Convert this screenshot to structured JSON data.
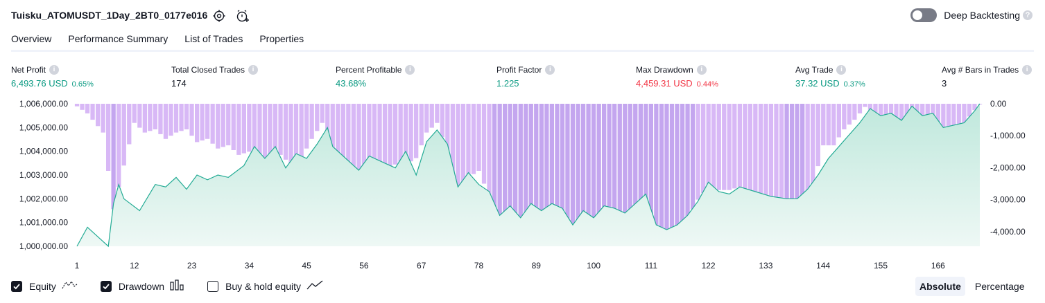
{
  "header": {
    "strategy_title": "Tuisku_ATOMUSDT_1Day_2BT0_0177e016",
    "deep_backtesting_label": "Deep Backtesting",
    "deep_backtesting_enabled": false,
    "help_glyph": "?"
  },
  "tabs": [
    {
      "label": "Overview",
      "active": true
    },
    {
      "label": "Performance Summary",
      "active": false
    },
    {
      "label": "List of Trades",
      "active": false
    },
    {
      "label": "Properties",
      "active": false
    }
  ],
  "metrics": [
    {
      "label": "Net Profit",
      "value": "6,493.76 USD",
      "pct": "0.65%",
      "color": "green"
    },
    {
      "label": "Total Closed Trades",
      "value": "174",
      "pct": "",
      "color": "dark"
    },
    {
      "label": "Percent Profitable",
      "value": "43.68%",
      "pct": "",
      "color": "green"
    },
    {
      "label": "Profit Factor",
      "value": "1.225",
      "pct": "",
      "color": "green"
    },
    {
      "label": "Max Drawdown",
      "value": "4,459.31 USD",
      "pct": "0.44%",
      "color": "red"
    },
    {
      "label": "Avg Trade",
      "value": "37.32 USD",
      "pct": "0.37%",
      "color": "green"
    },
    {
      "label": "Avg # Bars in Trades",
      "value": "3",
      "pct": "",
      "color": "dark"
    }
  ],
  "colors": {
    "equity_line": "#22ab94",
    "equity_fill_top": "#c8ebe2",
    "drawdown_bar": "#d8b8f6",
    "drawdown_bar_deep": "#c4a6ef",
    "green": "#089981",
    "red": "#f23645"
  },
  "chart_data": {
    "type": "area",
    "x_ticks": [
      "1",
      "12",
      "23",
      "34",
      "45",
      "56",
      "67",
      "78",
      "89",
      "100",
      "111",
      "122",
      "133",
      "144",
      "155",
      "166"
    ],
    "x_range": [
      1,
      174
    ],
    "left_axis": {
      "ticks": [
        "1,006,000.00",
        "1,005,000.00",
        "1,004,000.00",
        "1,003,000.00",
        "1,002,000.00",
        "1,001,000.00",
        "1,000,000.00"
      ],
      "ylim": [
        1000000,
        1006000
      ]
    },
    "right_axis": {
      "ticks": [
        "0.00",
        "-1,000.00",
        "-2,000.00",
        "-3,000.00",
        "-4,000.00"
      ],
      "ylim": [
        -4459.31,
        0
      ]
    },
    "series": [
      {
        "type": "area",
        "equity_keypoints": [
          [
            1,
            1000000
          ],
          [
            3,
            1000800
          ],
          [
            6,
            1000200
          ],
          [
            7,
            1000000
          ],
          [
            8,
            1001800
          ],
          [
            9,
            1002600
          ],
          [
            10,
            1002000
          ],
          [
            13,
            1001500
          ],
          [
            16,
            1002600
          ],
          [
            18,
            1002500
          ],
          [
            20,
            1002900
          ],
          [
            22,
            1002400
          ],
          [
            24,
            1003000
          ],
          [
            26,
            1002800
          ],
          [
            28,
            1003000
          ],
          [
            30,
            1002900
          ],
          [
            33,
            1003400
          ],
          [
            35,
            1004200
          ],
          [
            37,
            1003700
          ],
          [
            39,
            1004200
          ],
          [
            41,
            1003300
          ],
          [
            43,
            1003900
          ],
          [
            45,
            1003700
          ],
          [
            47,
            1004300
          ],
          [
            49,
            1005000
          ],
          [
            50,
            1004200
          ],
          [
            52,
            1003800
          ],
          [
            55,
            1003200
          ],
          [
            57,
            1003800
          ],
          [
            59,
            1003600
          ],
          [
            62,
            1003300
          ],
          [
            64,
            1004000
          ],
          [
            66,
            1003000
          ],
          [
            68,
            1004400
          ],
          [
            70,
            1004900
          ],
          [
            72,
            1004300
          ],
          [
            74,
            1002500
          ],
          [
            76,
            1003100
          ],
          [
            78,
            1002600
          ],
          [
            80,
            1002300
          ],
          [
            82,
            1001300
          ],
          [
            84,
            1001700
          ],
          [
            86,
            1001200
          ],
          [
            88,
            1001800
          ],
          [
            90,
            1001500
          ],
          [
            92,
            1001800
          ],
          [
            94,
            1001600
          ],
          [
            96,
            1000900
          ],
          [
            98,
            1001500
          ],
          [
            100,
            1001200
          ],
          [
            102,
            1001700
          ],
          [
            104,
            1001600
          ],
          [
            106,
            1001400
          ],
          [
            108,
            1001800
          ],
          [
            110,
            1002200
          ],
          [
            112,
            1000900
          ],
          [
            114,
            1000700
          ],
          [
            116,
            1000900
          ],
          [
            118,
            1001300
          ],
          [
            120,
            1001900
          ],
          [
            122,
            1002700
          ],
          [
            124,
            1002300
          ],
          [
            126,
            1002200
          ],
          [
            128,
            1002500
          ],
          [
            131,
            1002300
          ],
          [
            134,
            1002100
          ],
          [
            137,
            1002000
          ],
          [
            139,
            1002000
          ],
          [
            141,
            1002400
          ],
          [
            143,
            1003000
          ],
          [
            145,
            1003700
          ],
          [
            147,
            1004200
          ],
          [
            149,
            1004700
          ],
          [
            151,
            1005200
          ],
          [
            153,
            1005800
          ],
          [
            155,
            1005500
          ],
          [
            157,
            1005600
          ],
          [
            159,
            1005300
          ],
          [
            161,
            1005900
          ],
          [
            163,
            1005500
          ],
          [
            165,
            1005600
          ],
          [
            167,
            1005000
          ],
          [
            169,
            1005100
          ],
          [
            171,
            1005200
          ],
          [
            173,
            1005700
          ],
          [
            174,
            1006000
          ]
        ]
      },
      {
        "type": "bar",
        "drawdown_keypoints": [
          [
            1,
            -80
          ],
          [
            3,
            -300
          ],
          [
            6,
            -900
          ],
          [
            8,
            -3300
          ],
          [
            9,
            -2600
          ],
          [
            12,
            -600
          ],
          [
            14,
            -900
          ],
          [
            16,
            -800
          ],
          [
            18,
            -1100
          ],
          [
            20,
            -900
          ],
          [
            22,
            -800
          ],
          [
            24,
            -1200
          ],
          [
            26,
            -1100
          ],
          [
            28,
            -1400
          ],
          [
            30,
            -1300
          ],
          [
            32,
            -1600
          ],
          [
            34,
            -1500
          ],
          [
            36,
            -1800
          ],
          [
            38,
            -1700
          ],
          [
            40,
            -1600
          ],
          [
            42,
            -1900
          ],
          [
            44,
            -1700
          ],
          [
            46,
            -1100
          ],
          [
            48,
            -600
          ],
          [
            50,
            -1900
          ],
          [
            52,
            -2200
          ],
          [
            54,
            -2400
          ],
          [
            56,
            -2000
          ],
          [
            58,
            -2000
          ],
          [
            60,
            -2100
          ],
          [
            62,
            -1900
          ],
          [
            64,
            -1900
          ],
          [
            66,
            -1700
          ],
          [
            68,
            -900
          ],
          [
            70,
            -600
          ],
          [
            72,
            -1500
          ],
          [
            74,
            -2800
          ],
          [
            76,
            -2300
          ],
          [
            78,
            -2100
          ],
          [
            80,
            -2900
          ],
          [
            82,
            -4200
          ],
          [
            84,
            -3800
          ],
          [
            86,
            -4300
          ],
          [
            88,
            -3800
          ],
          [
            90,
            -4100
          ],
          [
            92,
            -3900
          ],
          [
            94,
            -4000
          ],
          [
            96,
            -4459
          ],
          [
            98,
            -4100
          ],
          [
            100,
            -4300
          ],
          [
            102,
            -3600
          ],
          [
            104,
            -4000
          ],
          [
            106,
            -4200
          ],
          [
            108,
            -3500
          ],
          [
            110,
            -3200
          ],
          [
            112,
            -4300
          ],
          [
            114,
            -4400
          ],
          [
            116,
            -4200
          ],
          [
            118,
            -3600
          ],
          [
            120,
            -3000
          ],
          [
            122,
            -2600
          ],
          [
            124,
            -2700
          ],
          [
            126,
            -2700
          ],
          [
            128,
            -2600
          ],
          [
            130,
            -2800
          ],
          [
            132,
            -2800
          ],
          [
            134,
            -2900
          ],
          [
            136,
            -3000
          ],
          [
            138,
            -3200
          ],
          [
            140,
            -3100
          ],
          [
            142,
            -2600
          ],
          [
            144,
            -1300
          ],
          [
            146,
            -1300
          ],
          [
            148,
            -800
          ],
          [
            150,
            -500
          ],
          [
            152,
            -100
          ],
          [
            154,
            -300
          ],
          [
            156,
            -500
          ],
          [
            158,
            -800
          ],
          [
            160,
            -900
          ],
          [
            162,
            -300
          ],
          [
            164,
            -600
          ],
          [
            166,
            -900
          ],
          [
            168,
            -1000
          ],
          [
            170,
            -1000
          ],
          [
            172,
            -400
          ],
          [
            174,
            0
          ]
        ]
      }
    ]
  },
  "legend": [
    {
      "label": "Equity",
      "checked": true,
      "icon": "equity-line-icon"
    },
    {
      "label": "Drawdown",
      "checked": true,
      "icon": "drawdown-bars-icon"
    },
    {
      "label": "Buy & hold equity",
      "checked": false,
      "icon": "buy-hold-line-icon"
    }
  ],
  "mode": {
    "absolute": "Absolute",
    "percentage": "Percentage"
  }
}
